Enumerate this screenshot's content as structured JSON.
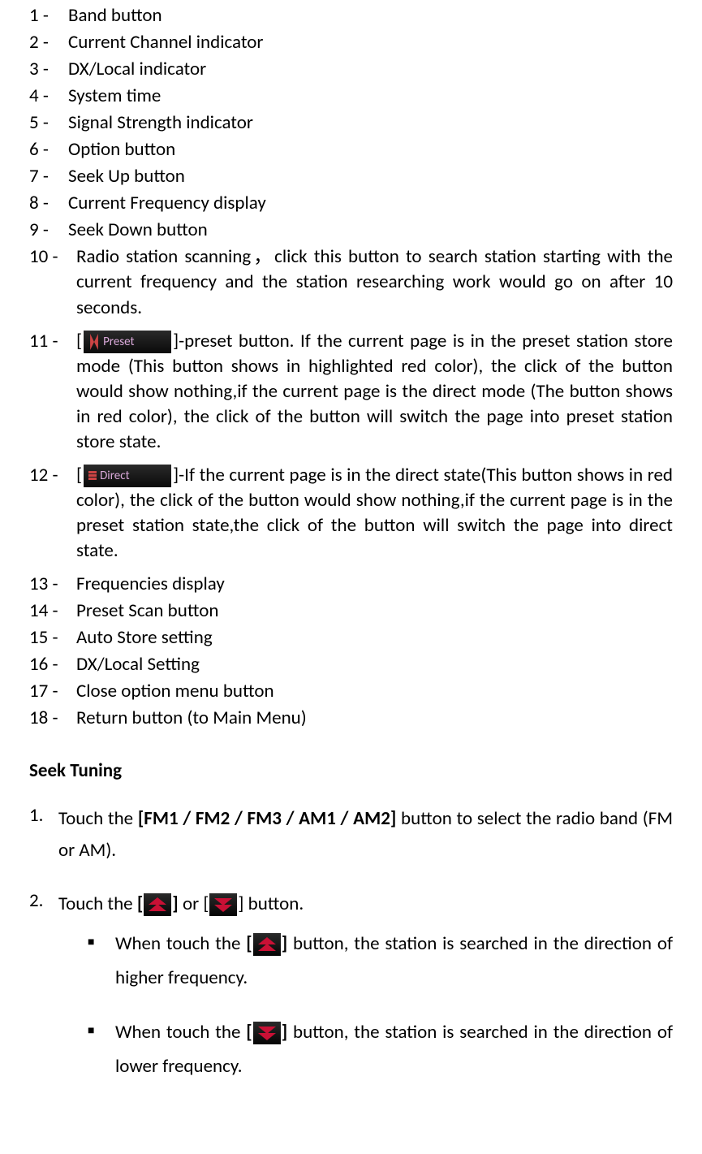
{
  "items": [
    {
      "n": "1 -",
      "text": "Band button"
    },
    {
      "n": "2 -",
      "text": "Current Channel indicator"
    },
    {
      "n": "3 -",
      "text": "DX/Local indicator"
    },
    {
      "n": "4 -",
      "text": "System time"
    },
    {
      "n": "5 -",
      "text": "Signal Strength indicator"
    },
    {
      "n": "6 -",
      "text": "Option button"
    },
    {
      "n": "7 -",
      "text": "Seek Up button"
    },
    {
      "n": "8 -",
      "text": "Current Frequency display"
    },
    {
      "n": "9 -",
      "text": "Seek Down button"
    }
  ],
  "item10": {
    "n": "10 -",
    "text": "Radio station scanning，click this button to search station starting with the current frequency and the station researching work would go on after 10 seconds."
  },
  "item11": {
    "n": "11 -",
    "badge": "Preset",
    "pre": "[",
    "post": "]-preset button. If the current page is in the preset station store mode (This button shows in highlighted red color), the click of the button would show nothing,if the current page is the direct mode (The button shows in red color), the click of the button will switch the page into preset station store state."
  },
  "item12": {
    "n": "12 -",
    "badge": "Direct",
    "pre": "[",
    "post": "]-If the current page is in the direct state(This button shows in red color), the click of the button would show nothing,if the current page is in the preset station state,the click of the button will switch the page into direct state."
  },
  "items2": [
    {
      "n": "13 -",
      "text": "Frequencies display"
    },
    {
      "n": "14 -",
      "text": "Preset Scan button"
    },
    {
      "n": "15 -",
      "text": "Auto Store setting"
    },
    {
      "n": "16 -",
      "text": "DX/Local Setting"
    },
    {
      "n": "17 -",
      "text": "Close option menu button"
    },
    {
      "n": "18 -",
      "text": "Return button (to Main Menu)"
    }
  ],
  "heading": "Seek Tuning",
  "seek1": {
    "n": "1.",
    "pre": "Touch the ",
    "bold": "[FM1 / FM2 / FM3 / AM1 / AM2]",
    "post": " button to select the radio band (FM or AM)."
  },
  "seek2": {
    "n": "2.",
    "pre": "Touch the ",
    "b1": "[",
    "b2": "]",
    "mid": " or ",
    "b3": "[",
    "b4": "]",
    "post": " button."
  },
  "sub1": {
    "pre": "When touch the ",
    "b1": "[",
    "b2": "]",
    "post": " button, the station is searched in the direction of higher frequency."
  },
  "sub2": {
    "pre": "When touch the ",
    "b1": "[",
    "b2": "]",
    "post": " button, the station is searched in the direction of lower frequency."
  }
}
